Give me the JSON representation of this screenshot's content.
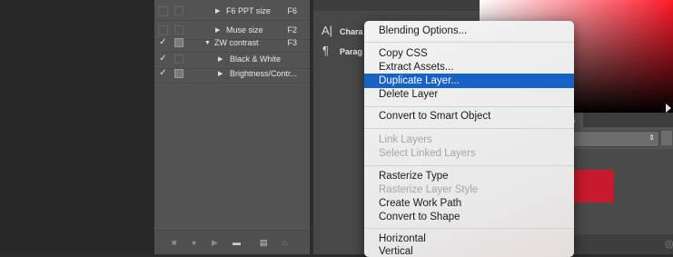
{
  "actions": [
    {
      "checked": false,
      "dialog": "empty",
      "expanded": false,
      "indent": 1,
      "label": "F6 PPT size",
      "key": "F6"
    },
    {
      "checked": false,
      "dialog": "empty",
      "expanded": false,
      "indent": 1,
      "label": "Muse size",
      "key": "F2"
    },
    {
      "checked": true,
      "dialog": "full",
      "expanded": true,
      "indent": 1,
      "label": "ZW contrast",
      "key": "F3"
    },
    {
      "checked": true,
      "dialog": "empty",
      "expanded": false,
      "indent": 2,
      "label": "Black & White",
      "key": ""
    },
    {
      "checked": true,
      "dialog": "full",
      "expanded": false,
      "indent": 2,
      "label": "Brightness/Contr...",
      "key": ""
    }
  ],
  "char_panel": {
    "character_label": "Chara",
    "paragraph_label": "Parag"
  },
  "right_panel": {
    "tab_label": "es",
    "accent_color": "#c81a2e"
  },
  "menu": {
    "items": [
      {
        "label": "Blending Options...",
        "state": "normal"
      },
      {
        "label": "Copy CSS",
        "state": "normal"
      },
      {
        "label": "Extract Assets...",
        "state": "normal"
      },
      {
        "label": "Duplicate Layer...",
        "state": "highlighted"
      },
      {
        "label": "Delete Layer",
        "state": "normal"
      },
      {
        "label": "Convert to Smart Object",
        "state": "normal"
      },
      {
        "label": "Link Layers",
        "state": "disabled"
      },
      {
        "label": "Select Linked Layers",
        "state": "disabled"
      },
      {
        "label": "Rasterize Type",
        "state": "normal"
      },
      {
        "label": "Rasterize Layer Style",
        "state": "disabled"
      },
      {
        "label": "Create Work Path",
        "state": "normal"
      },
      {
        "label": "Convert to Shape",
        "state": "normal"
      },
      {
        "label": "Horizontal",
        "state": "normal"
      },
      {
        "label": "Vertical",
        "state": "normal"
      }
    ],
    "highlight_color": "#1762c4"
  }
}
